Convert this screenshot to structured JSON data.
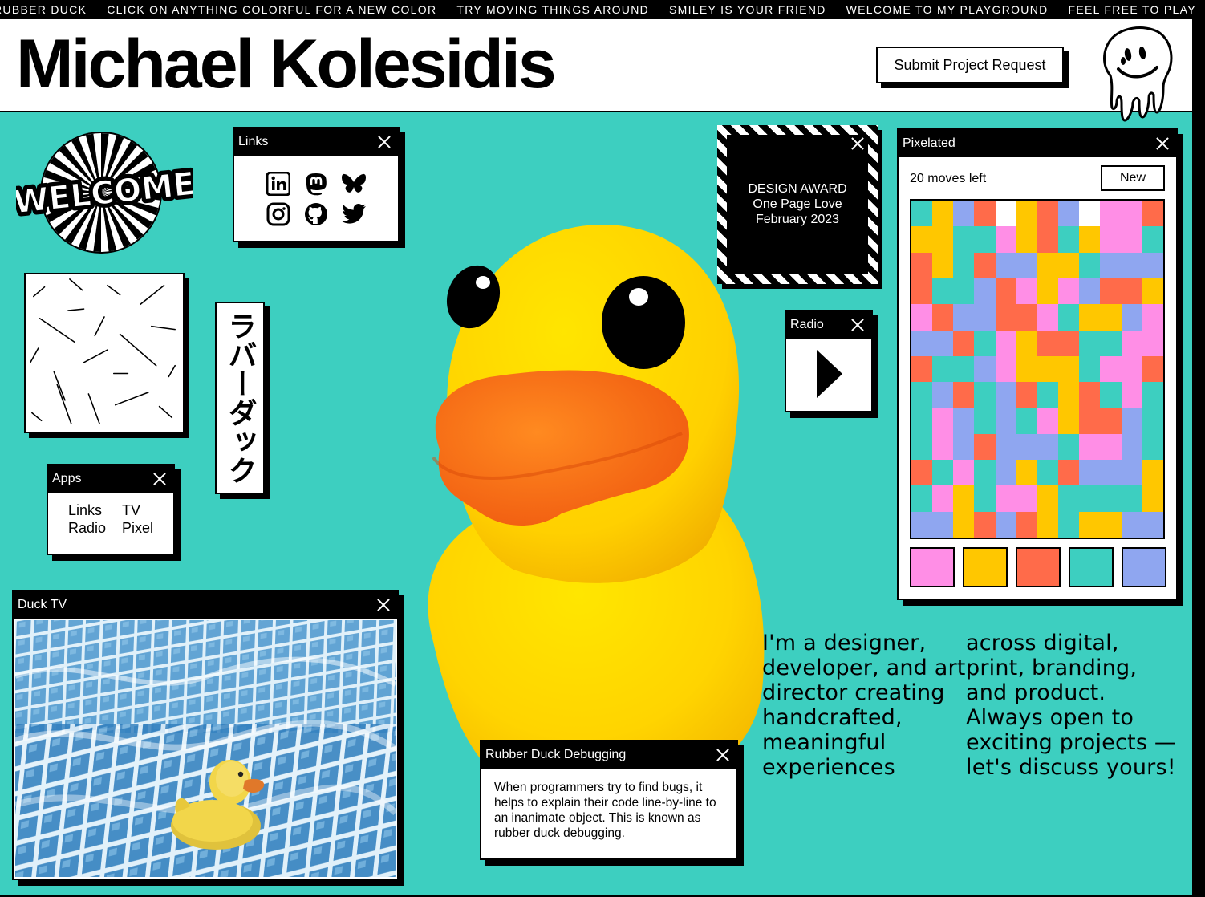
{
  "marquee": {
    "items": [
      "RUBBER DUCK",
      "CLICK ON ANYTHING COLORFUL FOR A NEW COLOR",
      "TRY MOVING THINGS AROUND",
      "SMILEY IS YOUR FRIEND",
      "WELCOME TO MY PLAYGROUND",
      "FEEL FREE TO PLAY"
    ]
  },
  "header": {
    "title": "Michael Kolesidis",
    "cta_label": "Submit Project Request",
    "logo_icon": "melting-smiley-icon"
  },
  "welcome": {
    "text": "WELCOME"
  },
  "links": {
    "title": "Links",
    "icons": [
      "linkedin-icon",
      "mastodon-icon",
      "bluesky-icon",
      "instagram-icon",
      "github-icon",
      "twitter-icon"
    ]
  },
  "katakana": {
    "text": "ラバーダック"
  },
  "apps": {
    "title": "Apps",
    "items": [
      "Links",
      "TV",
      "Radio",
      "Pixel"
    ]
  },
  "duck_tv": {
    "title": "Duck TV"
  },
  "rubber_duck_debugging": {
    "title": "Rubber Duck Debugging",
    "body": "When programmers try to find bugs, it helps to explain their code line-by-line to an inanimate object. This is known as rubber duck debugging."
  },
  "award": {
    "line1": "DESIGN AWARD",
    "line2": "One Page Love",
    "line3": "February 2023"
  },
  "radio": {
    "title": "Radio"
  },
  "pixelated": {
    "title": "Pixelated",
    "moves": "20 moves left",
    "new_label": "New",
    "palette": [
      "#ff8ee6",
      "#ffc700",
      "#ff6b4a",
      "#3dcfc0",
      "#8fa6f0"
    ],
    "grid": [
      "TYBRPYRBPMMR",
      "YYTTMYRTYMMT",
      "RYTRBBYYTBBB",
      "RTTBRMYMBRRY",
      "MRBBRRMTYYBM",
      "BBRTMYRRTTMM",
      "RTTBMYYYTMMR",
      "TBRTBRTYRTMT",
      "TMBTBTMYRRBT",
      "TMBRBBBTMMBT",
      "RTMTBYTRBBBY",
      "TMYTMMYTTTTY",
      "BBYRBRYTYYBB"
    ]
  },
  "intro": {
    "col1": "I'm a designer, developer, and art director creating handcrafted, meaningful experiences",
    "col2": "across digital, print, branding, and product. Always open to exciting projects — let's discuss yours!"
  }
}
